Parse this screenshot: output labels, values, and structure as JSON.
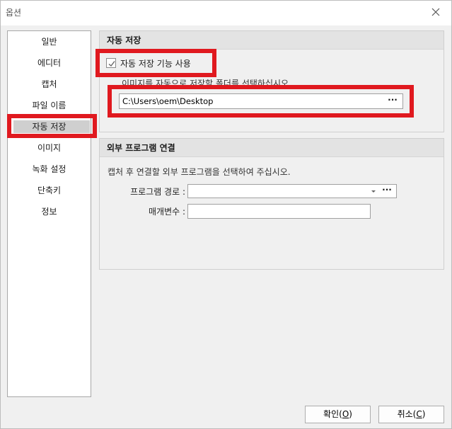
{
  "window": {
    "title": "옵션",
    "close_icon": "close-icon"
  },
  "nav": {
    "items": [
      {
        "label": "일반",
        "selected": false
      },
      {
        "label": "에디터",
        "selected": false
      },
      {
        "label": "캡처",
        "selected": false
      },
      {
        "label": "파일 이름",
        "selected": false
      },
      {
        "label": "자동 저장",
        "selected": true
      },
      {
        "label": "이미지",
        "selected": false
      },
      {
        "label": "녹화 설정",
        "selected": false
      },
      {
        "label": "단축키",
        "selected": false
      },
      {
        "label": "정보",
        "selected": false
      }
    ]
  },
  "autosave": {
    "header": "자동 저장",
    "checkbox_label": "자동 저장 기능 사용",
    "checkbox_checked": true,
    "hint": "이미지를 자동으로 저장할 폴더를 선택하십시오.",
    "folder_path": "C:\\Users\\oem\\Desktop",
    "browse_label": "···"
  },
  "external": {
    "header": "외부 프로그램 연결",
    "hint": "캡처 후 연결할 외부 프로그램을 선택하여 주십시오.",
    "program_path_label": "프로그램 경로 :",
    "program_path_value": "",
    "browse_label": "···",
    "params_label": "매개변수 :",
    "params_value": ""
  },
  "buttons": {
    "ok_label": "확인",
    "ok_mnemonic": "(O)",
    "ok_mnemonic_letter": "O",
    "cancel_label": "취소",
    "cancel_mnemonic_letter": "C"
  },
  "colors": {
    "highlight": "#e0191f",
    "selected_bg": "#cfcfcf",
    "panel_header_bg": "#e3e3e3"
  }
}
